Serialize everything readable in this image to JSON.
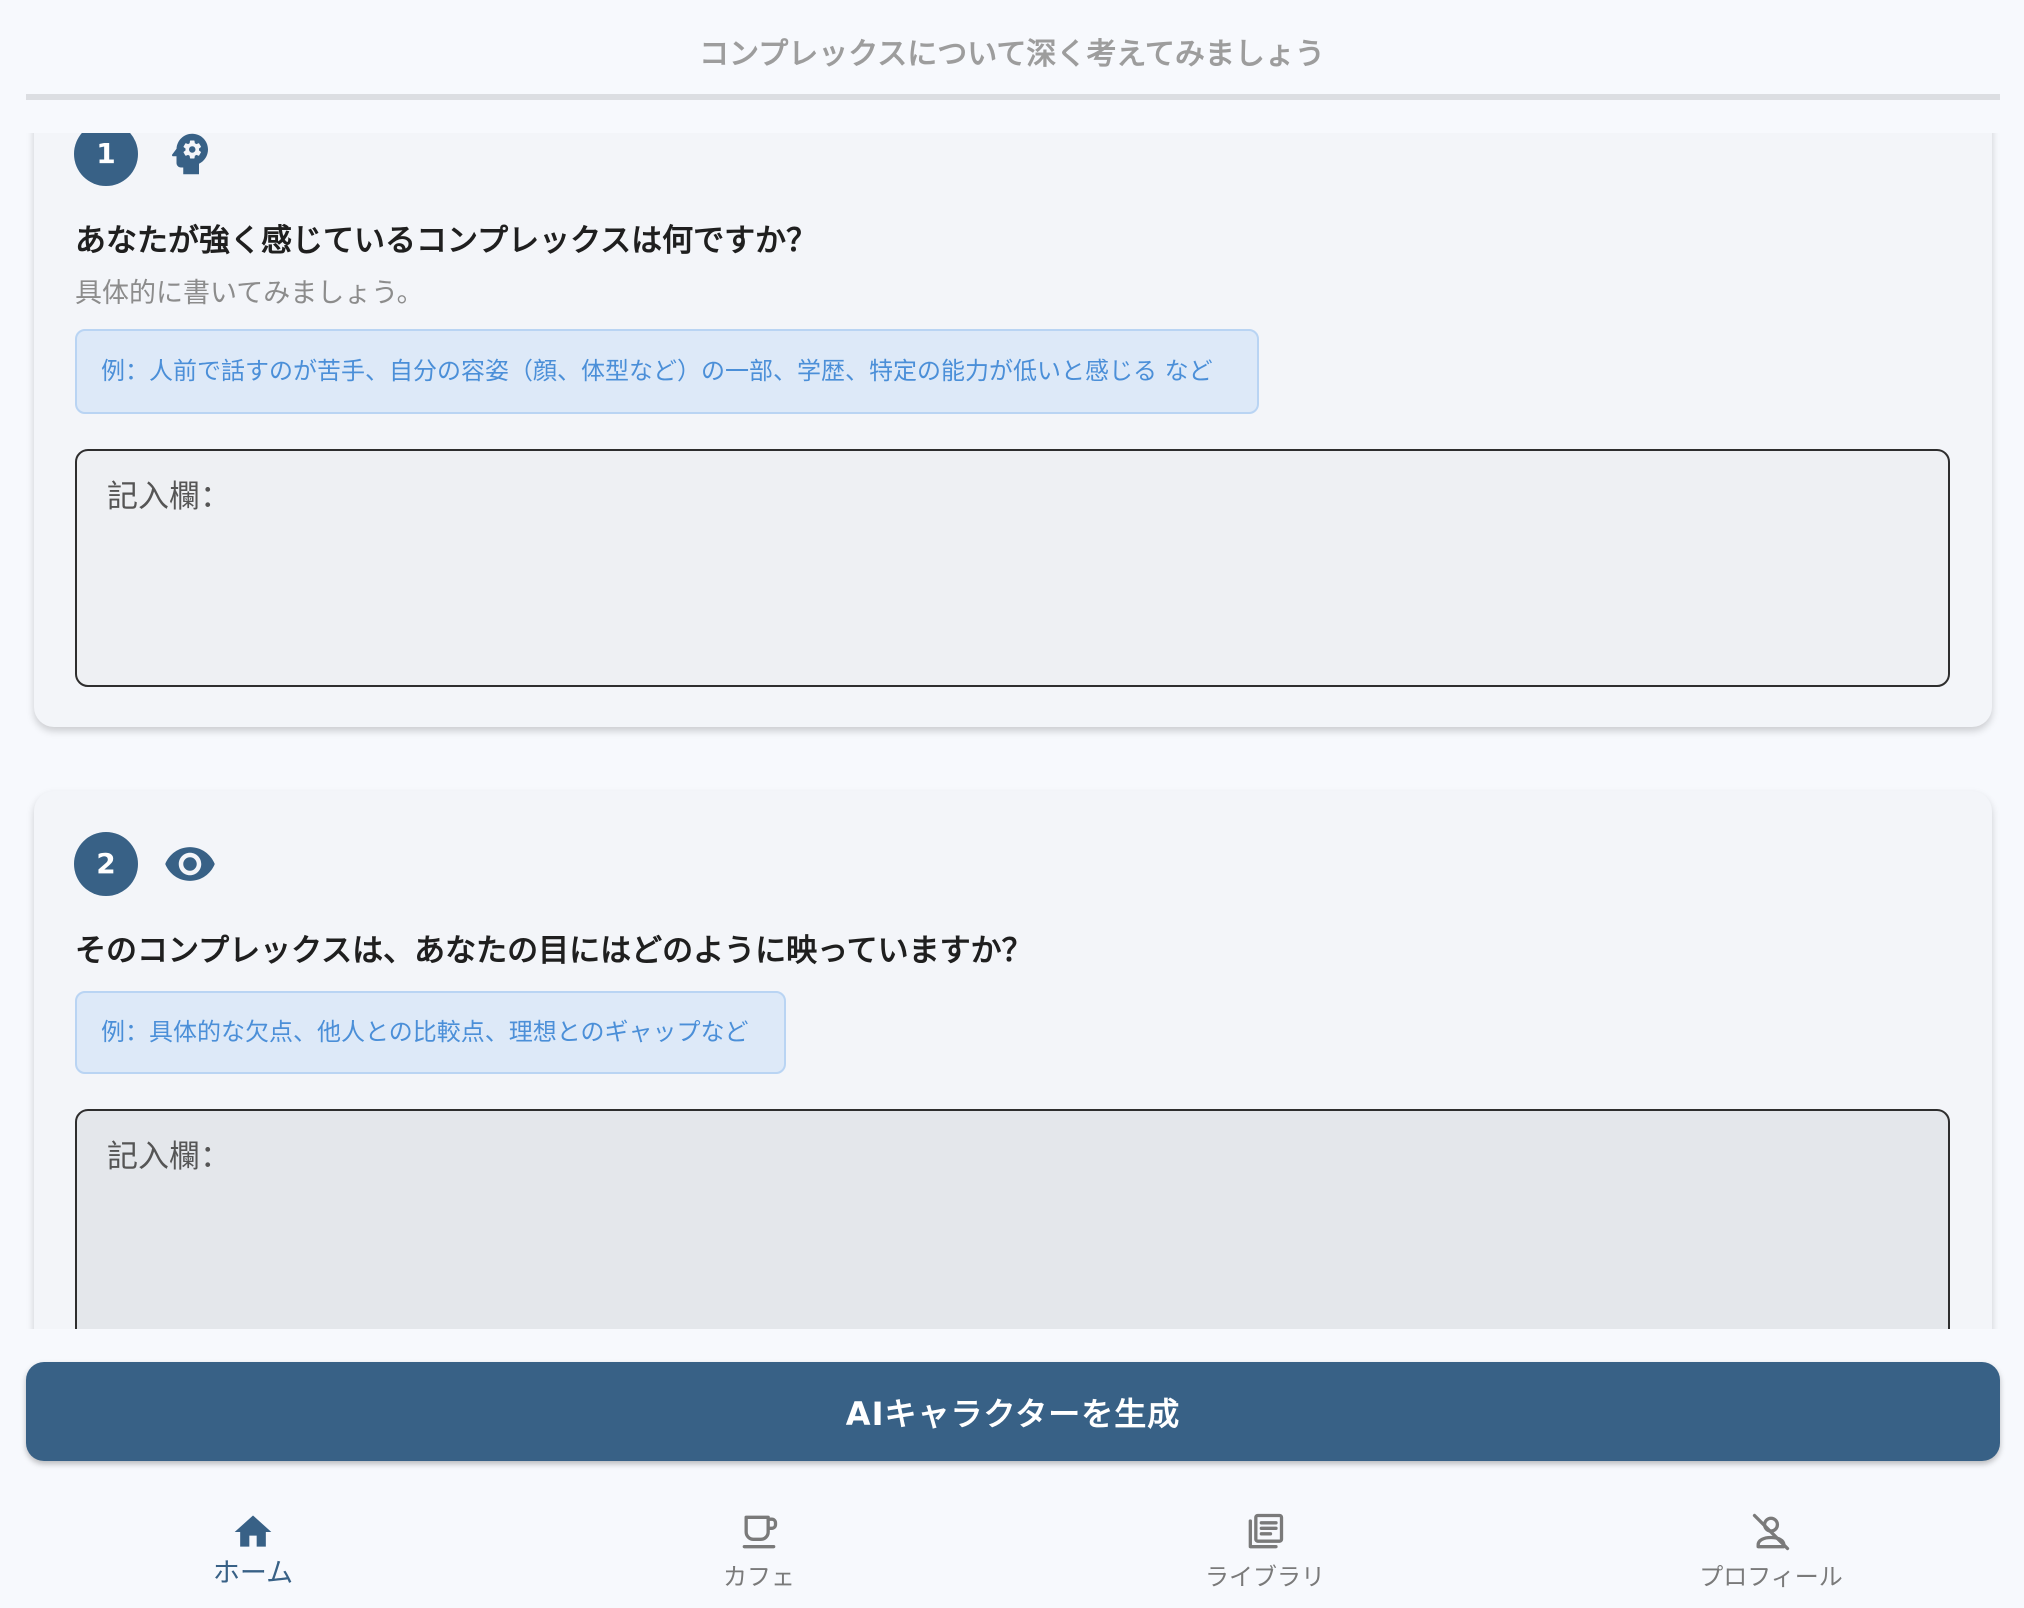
{
  "header": {
    "title": "コンプレックスについて深く考えてみましょう"
  },
  "questions": [
    {
      "number": "1",
      "icon": "psychology-icon",
      "question": "あなたが強く感じているコンプレックスは何ですか？",
      "hint": "具体的に書いてみましょう。",
      "example": "例：人前で話すのが苦手、自分の容姿（顔、体型など）の一部、学歴、特定の能力が低いと感じる など",
      "input": {
        "placeholder": "記入欄："
      }
    },
    {
      "number": "2",
      "icon": "eye-icon",
      "question": "そのコンプレックスは、あなたの目にはどのように映っていますか？",
      "example": "例：具体的な欠点、他人との比較点、理想とのギャップなど",
      "input": {
        "placeholder": "記入欄："
      }
    }
  ],
  "actions": {
    "generate_label": "AIキャラクターを生成"
  },
  "nav": {
    "items": [
      {
        "label": "ホーム",
        "icon": "home-icon",
        "active": true
      },
      {
        "label": "カフェ",
        "icon": "coffee-cup-icon",
        "active": false
      },
      {
        "label": "ライブラリ",
        "icon": "library-books-icon",
        "active": false
      },
      {
        "label": "プロフィール",
        "icon": "person-off-icon",
        "active": false
      }
    ]
  },
  "colors": {
    "primary": "#386186",
    "page_background": "#f7f9fd",
    "card_background": "#f3f5f9",
    "example_background": "#dde9f8",
    "example_border": "#b9d4f3",
    "example_text": "#4b8fd8",
    "inactive_nav": "#7a7a7a"
  }
}
